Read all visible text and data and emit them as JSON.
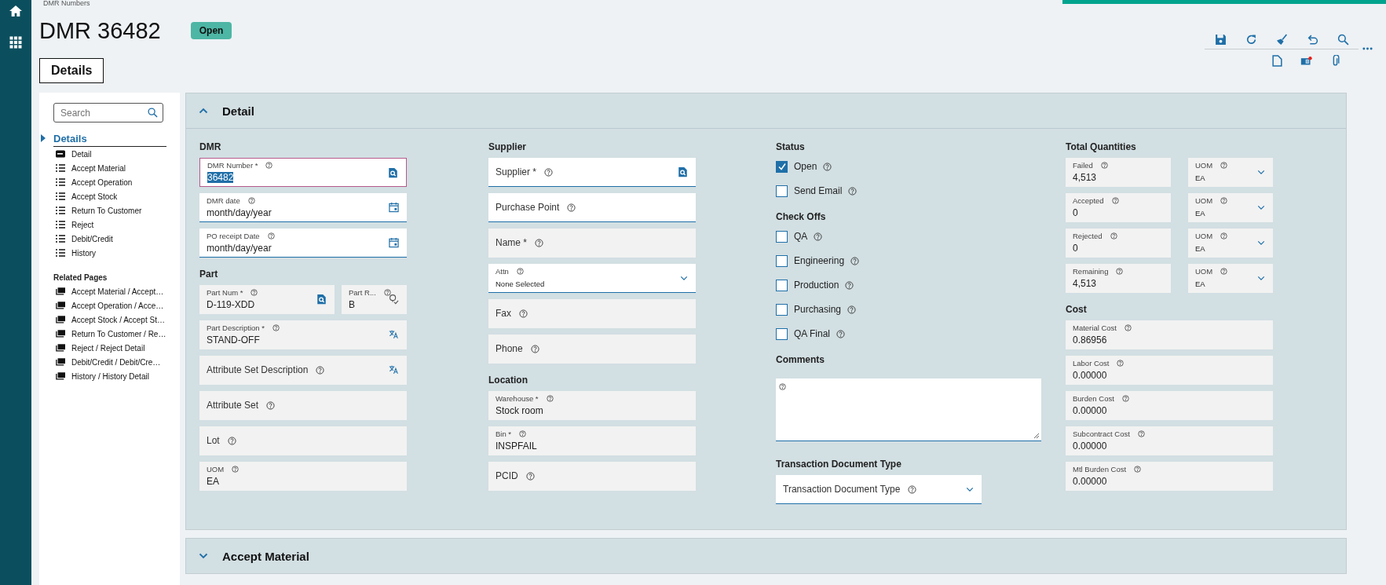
{
  "breadcrumb": "DMR Numbers",
  "title": "DMR 36482",
  "status_badge": "Open",
  "toolbar": {
    "notice_dot": true
  },
  "tabs": [
    {
      "label": "Details",
      "selected": true
    }
  ],
  "sidebar": {
    "search_placeholder": "Search",
    "group": {
      "label": "Details",
      "expanded": true,
      "items": [
        {
          "label": "Detail",
          "kind": "card"
        },
        {
          "label": "Accept Material",
          "kind": "list"
        },
        {
          "label": "Accept Operation",
          "kind": "list"
        },
        {
          "label": "Accept Stock",
          "kind": "list"
        },
        {
          "label": "Return To Customer",
          "kind": "list"
        },
        {
          "label": "Reject",
          "kind": "list"
        },
        {
          "label": "Debit/Credit",
          "kind": "list"
        },
        {
          "label": "History",
          "kind": "list"
        }
      ]
    },
    "related": {
      "heading": "Related Pages",
      "items": [
        "Accept Material / Accept…",
        "Accept Operation / Acce…",
        "Accept Stock / Accept St…",
        "Return To Customer / Re…",
        "Reject / Reject Detail",
        "Debit/Credit / Debit/Cre…",
        "History / History Detail"
      ]
    }
  },
  "sections": [
    {
      "title": "Detail",
      "expanded": true,
      "columns": [
        {
          "blocks": [
            {
              "heading": "DMR",
              "kind": "fields",
              "items": [
                {
                  "kind": "lookup",
                  "label": "DMR Number *",
                  "value": "36482",
                  "readonly": false,
                  "focused": true
                },
                {
                  "kind": "date",
                  "label": "DMR date",
                  "value": "month/day/year",
                  "readonly": false,
                  "focused": false
                },
                {
                  "kind": "date",
                  "label": "PO receipt Date",
                  "value": "month/day/year",
                  "readonly": false,
                  "focused": false
                }
              ]
            },
            {
              "heading": "Part",
              "kind": "fields",
              "items": [
                {
                  "kind": "pair",
                  "fields": [
                    {
                      "kind": "lookup",
                      "label": "Part Num *",
                      "value": "D-119-XDD",
                      "readonly": true,
                      "focused": false
                    },
                    {
                      "kind": "revision",
                      "label": "Part R...",
                      "value": "B",
                      "readonly": true,
                      "focused": false
                    }
                  ]
                },
                {
                  "kind": "translatable",
                  "label": "Part Description *",
                  "value": "STAND-OFF",
                  "readonly": true,
                  "focused": false
                },
                {
                  "kind": "translatable",
                  "label": "Attribute Set Description",
                  "readonly": true,
                  "focused": false
                },
                {
                  "kind": "text",
                  "label": "Attribute Set",
                  "readonly": true,
                  "focused": false
                },
                {
                  "kind": "text",
                  "label": "Lot",
                  "readonly": true,
                  "focused": false
                },
                {
                  "kind": "text",
                  "label": "UOM",
                  "value": "EA",
                  "readonly": true,
                  "focused": false
                }
              ]
            }
          ]
        },
        {
          "blocks": [
            {
              "heading": "Supplier",
              "kind": "fields",
              "items": [
                {
                  "kind": "lookup",
                  "label": "Supplier *",
                  "readonly": false,
                  "focused": false
                },
                {
                  "kind": "text",
                  "label": "Purchase Point",
                  "readonly": false,
                  "focused": false
                },
                {
                  "kind": "text",
                  "label": "Name *",
                  "readonly": true,
                  "focused": false
                },
                {
                  "kind": "select",
                  "label": "Attn",
                  "value": "None Selected",
                  "readonly": false,
                  "focused": false
                },
                {
                  "kind": "text",
                  "label": "Fax",
                  "readonly": true,
                  "focused": false
                },
                {
                  "kind": "text",
                  "label": "Phone",
                  "readonly": true,
                  "focused": false
                }
              ]
            },
            {
              "heading": "Location",
              "kind": "fields",
              "items": [
                {
                  "kind": "text",
                  "label": "Warehouse *",
                  "value": "Stock room",
                  "readonly": true,
                  "focused": false
                },
                {
                  "kind": "text",
                  "label": "Bin *",
                  "value": "INSPFAIL",
                  "readonly": true,
                  "focused": false
                },
                {
                  "kind": "text",
                  "label": "PCID",
                  "readonly": true,
                  "focused": false
                }
              ]
            }
          ]
        },
        {
          "blocks": [
            {
              "heading": "Status",
              "kind": "checks",
              "items": [
                {
                  "label": "Open",
                  "checked": true
                },
                {
                  "label": "Send Email",
                  "checked": false
                }
              ]
            },
            {
              "heading": "Check Offs",
              "kind": "checks",
              "items": [
                {
                  "label": "QA",
                  "checked": false
                },
                {
                  "label": "Engineering",
                  "checked": false
                },
                {
                  "label": "Production",
                  "checked": false
                },
                {
                  "label": "Purchasing",
                  "checked": false
                },
                {
                  "label": "QA Final",
                  "checked": false
                }
              ]
            },
            {
              "heading": "Comments",
              "kind": "textarea"
            },
            {
              "heading": "Transaction Document Type",
              "kind": "fields",
              "items": [
                {
                  "kind": "select",
                  "label": "Transaction Document Type",
                  "readonly": false,
                  "focused": false
                }
              ]
            }
          ]
        },
        {
          "blocks": [
            {
              "heading": "Total Quantities",
              "kind": "fields",
              "items": [
                {
                  "kind": "pair",
                  "fields": [
                    {
                      "kind": "text",
                      "label": "Failed",
                      "value": "4,513",
                      "readonly": true,
                      "focused": false
                    },
                    {
                      "kind": "select",
                      "label": "UOM",
                      "value": "EA",
                      "readonly": true,
                      "focused": false
                    }
                  ]
                },
                {
                  "kind": "pair",
                  "fields": [
                    {
                      "kind": "text",
                      "label": "Accepted",
                      "value": "0",
                      "readonly": true,
                      "focused": false
                    },
                    {
                      "kind": "select",
                      "label": "UOM",
                      "value": "EA",
                      "readonly": true,
                      "focused": false
                    }
                  ]
                },
                {
                  "kind": "pair",
                  "fields": [
                    {
                      "kind": "text",
                      "label": "Rejected",
                      "value": "0",
                      "readonly": true,
                      "focused": false
                    },
                    {
                      "kind": "select",
                      "label": "UOM",
                      "value": "EA",
                      "readonly": true,
                      "focused": false
                    }
                  ]
                },
                {
                  "kind": "pair",
                  "fields": [
                    {
                      "kind": "text",
                      "label": "Remaining",
                      "value": "4,513",
                      "readonly": true,
                      "focused": false
                    },
                    {
                      "kind": "select",
                      "label": "UOM",
                      "value": "EA",
                      "readonly": true,
                      "focused": false
                    }
                  ]
                }
              ]
            },
            {
              "heading": "Cost",
              "kind": "fields",
              "items": [
                {
                  "kind": "text",
                  "label": "Material Cost",
                  "value": "0.86956",
                  "readonly": true,
                  "focused": false
                },
                {
                  "kind": "text",
                  "label": "Labor Cost",
                  "value": "0.00000",
                  "readonly": true,
                  "focused": false
                },
                {
                  "kind": "text",
                  "label": "Burden Cost",
                  "value": "0.00000",
                  "readonly": true,
                  "focused": false
                },
                {
                  "kind": "text",
                  "label": "Subcontract Cost",
                  "value": "0.00000",
                  "readonly": true,
                  "focused": false
                },
                {
                  "kind": "text",
                  "label": "Mtl Burden Cost",
                  "value": "0.00000",
                  "readonly": true,
                  "focused": false
                }
              ]
            }
          ]
        }
      ]
    },
    {
      "title": "Accept Material",
      "expanded": false
    }
  ]
}
